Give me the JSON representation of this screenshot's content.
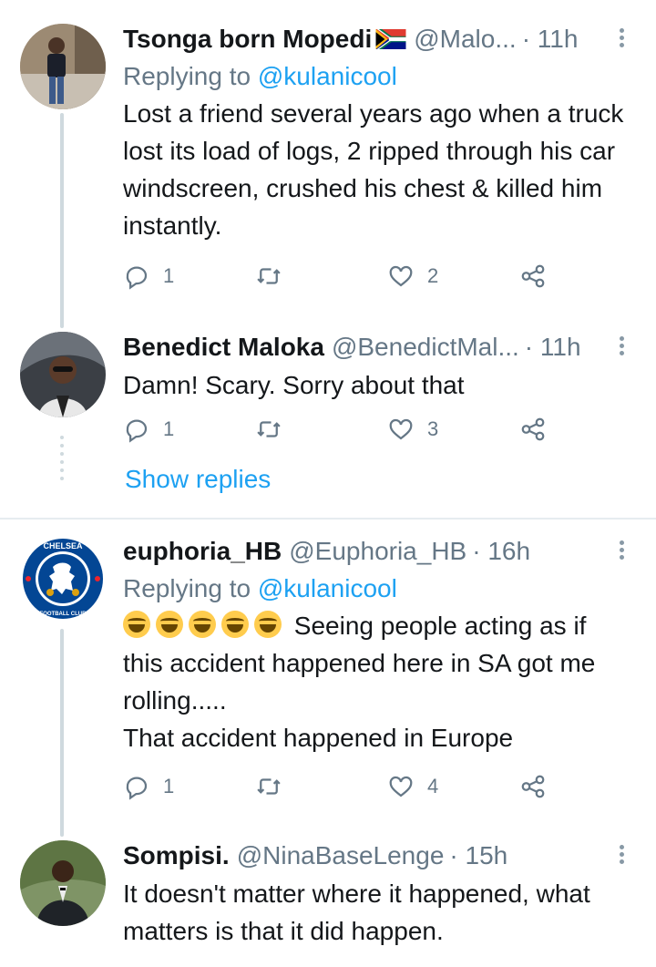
{
  "tweets": [
    {
      "name": "Tsonga born Mopedi",
      "handle": "@Malo...",
      "time": "· 11h",
      "replying_label": "Replying to",
      "replying_to": "@kulanicool",
      "text": "Lost a friend several years ago when a truck lost its load of logs, 2 ripped through his car windscreen, crushed his chest & killed him instantly.",
      "replies": "1",
      "retweets": "",
      "likes": "2"
    },
    {
      "name": "Benedict Maloka",
      "handle": "@BenedictMal...",
      "time": "· 11h",
      "text": "Damn! Scary. Sorry about that",
      "replies": "1",
      "retweets": "",
      "likes": "3",
      "show_replies": "Show replies"
    },
    {
      "name": "euphoria_HB",
      "handle": "@Euphoria_HB",
      "time": "· 16h",
      "replying_label": "Replying to",
      "replying_to": "@kulanicool",
      "text_after_emoji": "Seeing people acting as if this accident happened here in SA got me rolling.....",
      "text_line2": "That accident happened in Europe",
      "emoji_count": 5,
      "emoji_name": "face-with-tears-of-joy",
      "replies": "1",
      "retweets": "",
      "likes": "4",
      "avatar_badge_top": "CHELSEA",
      "avatar_badge_bottom": "FOOTBALL CLUB"
    },
    {
      "name": "Sompisi.",
      "handle": "@NinaBaseLenge",
      "time": "· 15h",
      "text": "It doesn't matter where it happened, what matters is that it did happen."
    }
  ],
  "colors": {
    "link": "#1da1f2",
    "secondary": "#657786",
    "thread_line": "#cfd9de",
    "divider": "#e6ecf0"
  }
}
